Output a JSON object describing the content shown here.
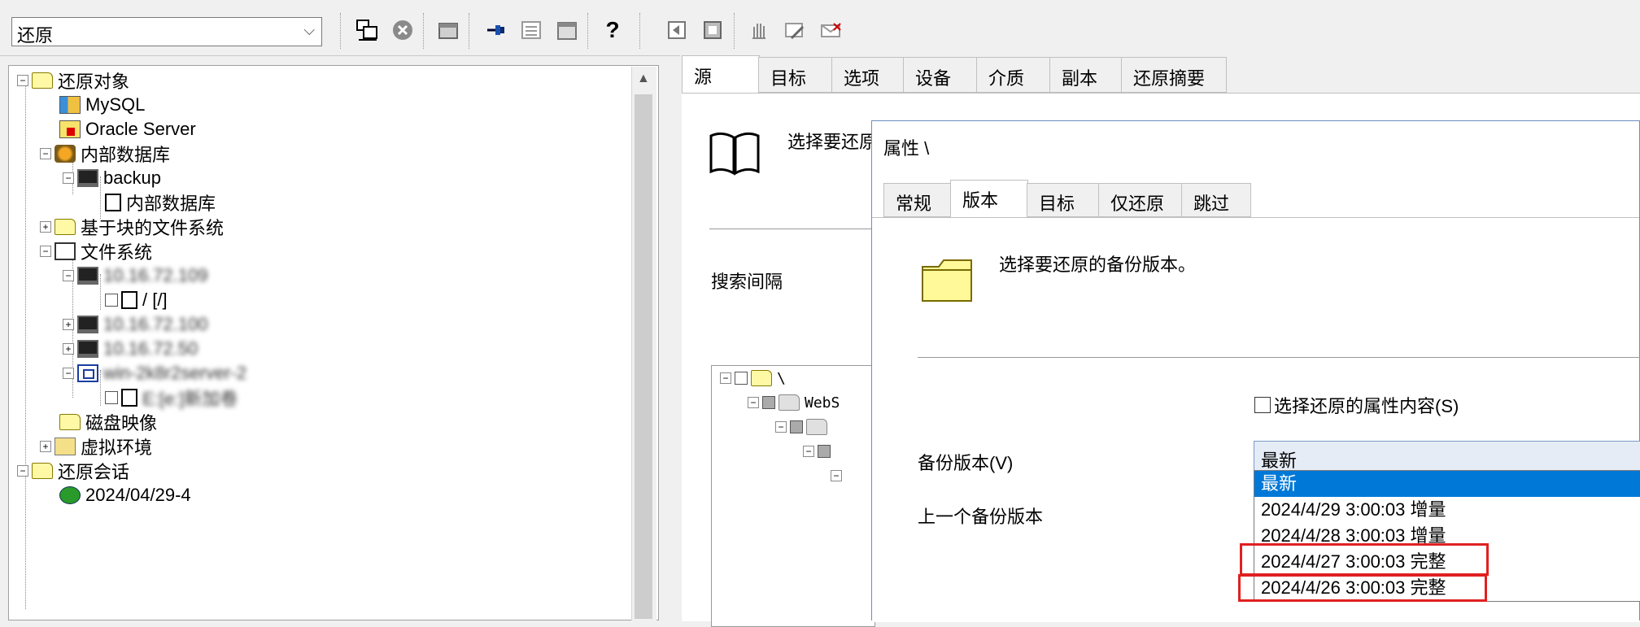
{
  "toolbar": {
    "mode_select": "还原",
    "icons": [
      "select-backup-icon",
      "cancel-icon",
      "job-icon",
      "pin-icon",
      "list-icon",
      "calendar-icon",
      "help-icon",
      "restore-source-icon",
      "restore-target-icon",
      "hand-icon",
      "edit-icon",
      "email-icon"
    ]
  },
  "left_tree": {
    "restore_objects": "还原对象",
    "mysql": "MySQL",
    "oracle": "Oracle Server",
    "internal_db": "内部数据库",
    "backup": "backup",
    "internal_db_child": "内部数据库",
    "block_fs": "基于块的文件系统",
    "filesystem": "文件系统",
    "host1": "10.16.72.109",
    "root_path": "/ [/]",
    "host2": "10.16.72.100",
    "host3": "10.16.72.50",
    "host4": "win-2k8r2server-2",
    "host4_child": "E:[e:]新加卷",
    "disk_image": "磁盘映像",
    "virtual_env": "虚拟环境",
    "restore_sessions": "还原会话",
    "session1": "2024/04/29-4"
  },
  "right": {
    "tabs": [
      "源",
      "目标",
      "选项",
      "设备",
      "介质",
      "副本",
      "还原摘要"
    ],
    "select_text": "选择要还原",
    "search_interval": "搜索间隔",
    "tree_root": "\\",
    "tree_child": "WebS"
  },
  "dialog": {
    "title": "属性 \\",
    "tabs": [
      "常规",
      "版本",
      "目标",
      "仅还原",
      "跳过"
    ],
    "instruction": "选择要还原的备份版本。",
    "checkbox_label": "选择还原的属性内容(S)",
    "version_label": "备份版本(V)",
    "prev_version_label": "上一个备份版本",
    "selected_version": "最新",
    "options": [
      "最新",
      "2024/4/29 3:00:03 增量",
      "2024/4/28 3:00:03 增量",
      "2024/4/27 3:00:03 完整",
      "2024/4/26 3:00:03 完整"
    ]
  }
}
